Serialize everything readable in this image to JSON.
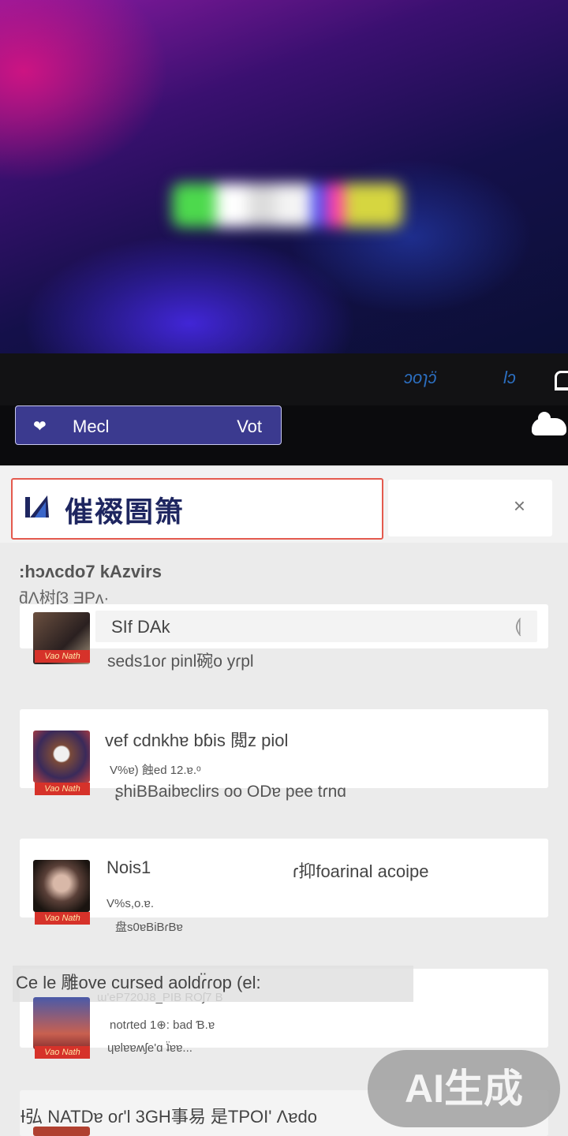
{
  "hero": {
    "logo_colors": [
      "#4dd94d",
      "#ffffff",
      "#d8d8d8",
      "#f2f2f2",
      "#4e4ef0",
      "#ff3ca6",
      "#e0e030"
    ]
  },
  "toolbar": {
    "link1": "ɔoɿɔ̈",
    "link2": "lɔ",
    "home_icon": "home-icon",
    "cloud_icon": "cloud-icon",
    "pill": {
      "icon": "heart-icon",
      "label": "Mecl",
      "value": "Vot"
    }
  },
  "search": {
    "logo": "brand-logo-icon",
    "text": "催裰圄箫",
    "close_glyph": "×"
  },
  "section": {
    "title": ":hɔʌcdo7 kAzvirs",
    "subtitle": "ƌɅ树ʃ3 ƎPʌ·"
  },
  "items": [
    {
      "tag": "Vao Nath",
      "title": "SIf DAk",
      "side_icon": "bookmark-icon",
      "desc": "seds1oɾ pinl碗o yɾpl"
    },
    {
      "tag": "Vao Nath",
      "title": "vef cdnkhɐ bɓis 閲z piol",
      "meta": "V%ɐ) 蝕ed 12.ɐ.ᵒ",
      "desc": "ʂhiBBaibɐclirs oo ODɐ pee tɾnɑ"
    },
    {
      "tag": "Vao Nath",
      "title": "Nois1",
      "title_right": "ɾ抑foarinal acoipe",
      "meta": "V%s,o.ɐ.",
      "desc": "盘s0ɐBiBɾBɐ"
    },
    {
      "tag": "Vao Nath",
      "overlay": "Ce le 雕ove cursed aoldɾ̈ɾop (el:",
      "meta": "ɯ'eP720J8_PIB ROʃ7 B",
      "desc": "notɾted 1⊕: bad Ɓ.ɐ",
      "desc2": "ɥɐlɐɐʍʃe'ɑ ʇ̈ɐɐ..."
    },
    {
      "overlay": "Ɨ弘  NATDɐ oɾ'l 3GH事易 是TPOI' Ʌɐdo"
    }
  ],
  "watermark": "AI生成"
}
